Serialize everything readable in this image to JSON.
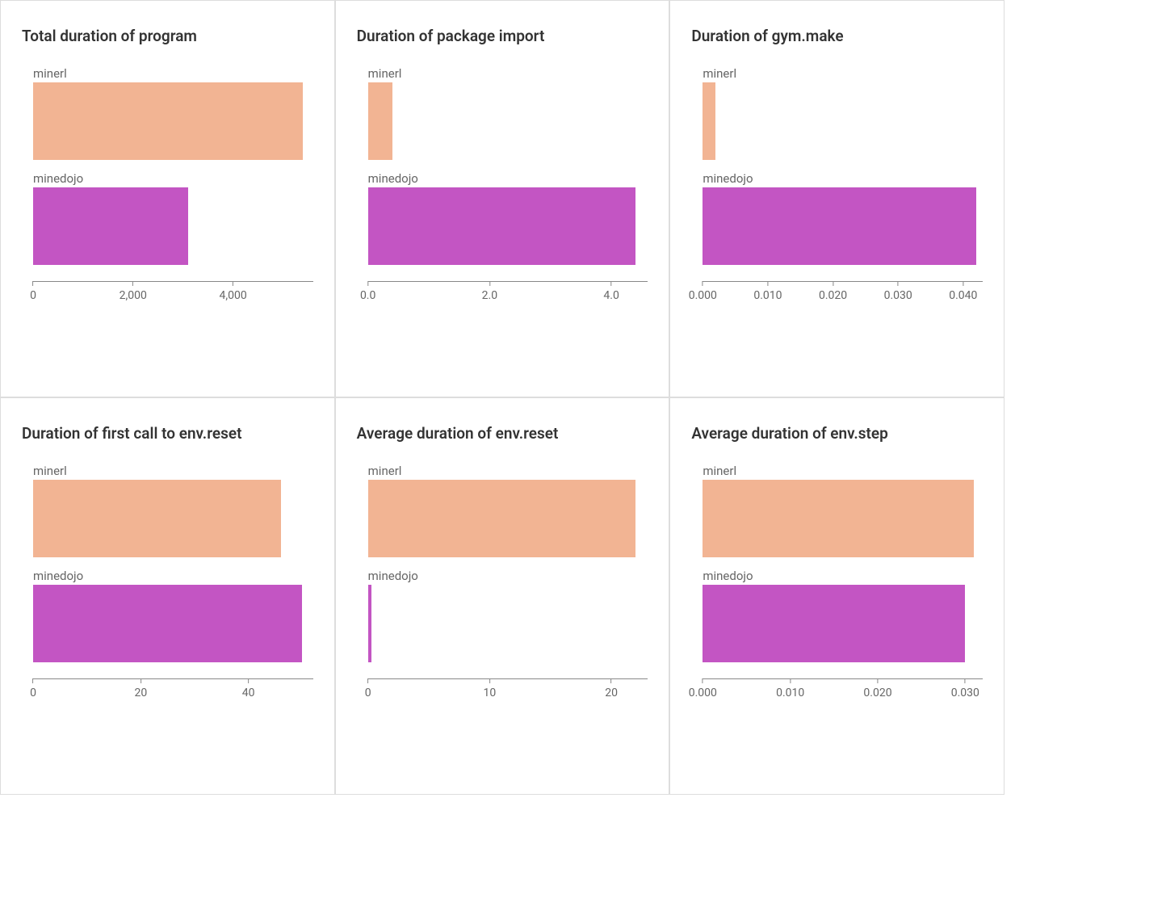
{
  "colors": {
    "minerl": "#f2b493",
    "minedojo": "#c355c3"
  },
  "chart_data": [
    {
      "title": "Total duration of program",
      "type": "bar",
      "categories": [
        "minerl",
        "minedojo"
      ],
      "values": [
        5400,
        3100
      ],
      "xlim": [
        0,
        5600
      ],
      "ticks": [
        0,
        2000,
        4000
      ],
      "tick_labels": [
        "0",
        "2,000",
        "4,000"
      ]
    },
    {
      "title": "Duration of package import",
      "type": "bar",
      "categories": [
        "minerl",
        "minedojo"
      ],
      "values": [
        0.4,
        4.4
      ],
      "xlim": [
        0,
        4.6
      ],
      "ticks": [
        0.0,
        2.0,
        4.0
      ],
      "tick_labels": [
        "0.0",
        "2.0",
        "4.0"
      ]
    },
    {
      "title": "Duration of gym.make",
      "type": "bar",
      "categories": [
        "minerl",
        "minedojo"
      ],
      "values": [
        0.002,
        0.042
      ],
      "xlim": [
        0,
        0.043
      ],
      "ticks": [
        0.0,
        0.01,
        0.02,
        0.03,
        0.04
      ],
      "tick_labels": [
        "0.000",
        "0.010",
        "0.020",
        "0.030",
        "0.040"
      ]
    },
    {
      "title": "Duration of first call to env.reset",
      "type": "bar",
      "categories": [
        "minerl",
        "minedojo"
      ],
      "values": [
        46,
        50
      ],
      "xlim": [
        0,
        52
      ],
      "ticks": [
        0,
        20,
        40
      ],
      "tick_labels": [
        "0",
        "20",
        "40"
      ]
    },
    {
      "title": "Average duration of env.reset",
      "type": "bar",
      "categories": [
        "minerl",
        "minedojo"
      ],
      "values": [
        22,
        0.3
      ],
      "xlim": [
        0,
        23
      ],
      "ticks": [
        0,
        10,
        20
      ],
      "tick_labels": [
        "0",
        "10",
        "20"
      ]
    },
    {
      "title": "Average duration of env.step",
      "type": "bar",
      "categories": [
        "minerl",
        "minedojo"
      ],
      "values": [
        0.031,
        0.03
      ],
      "xlim": [
        0,
        0.032
      ],
      "ticks": [
        0.0,
        0.01,
        0.02,
        0.03
      ],
      "tick_labels": [
        "0.000",
        "0.010",
        "0.020",
        "0.030"
      ]
    }
  ]
}
